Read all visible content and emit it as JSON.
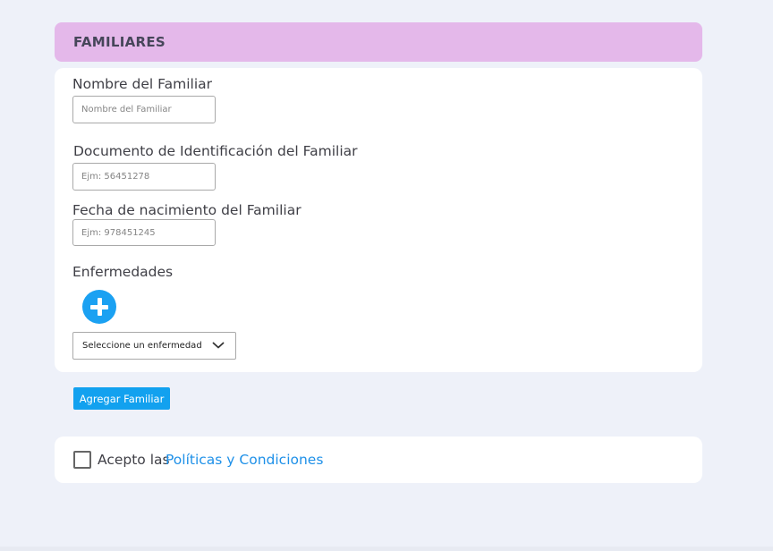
{
  "section": {
    "title": "FAMILIARES"
  },
  "form": {
    "name": {
      "label": "Nombre del Familiar",
      "placeholder": "Nombre del Familiar",
      "value": ""
    },
    "document": {
      "label": "Documento de Identificación del Familiar",
      "placeholder": "Ejm: 56451278",
      "value": ""
    },
    "birthdate": {
      "label": "Fecha de nacimiento del Familiar",
      "placeholder": "Ejm: 978451245",
      "value": ""
    },
    "diseases": {
      "label": "Enfermedades",
      "add_icon": "plus-circle-icon",
      "select_value": "Seleccione un enfermedad",
      "select_icon": "chevron-down-icon"
    }
  },
  "actions": {
    "add_family_label": "Agregar Familiar"
  },
  "terms": {
    "prefix": "Acepto las",
    "link": "Políticas y Condiciones",
    "checked": false
  },
  "colors": {
    "header_bg": "#e4b8ea",
    "accent": "#12a1ef",
    "link": "#1e90e8",
    "page_bg": "#eef1f9"
  }
}
